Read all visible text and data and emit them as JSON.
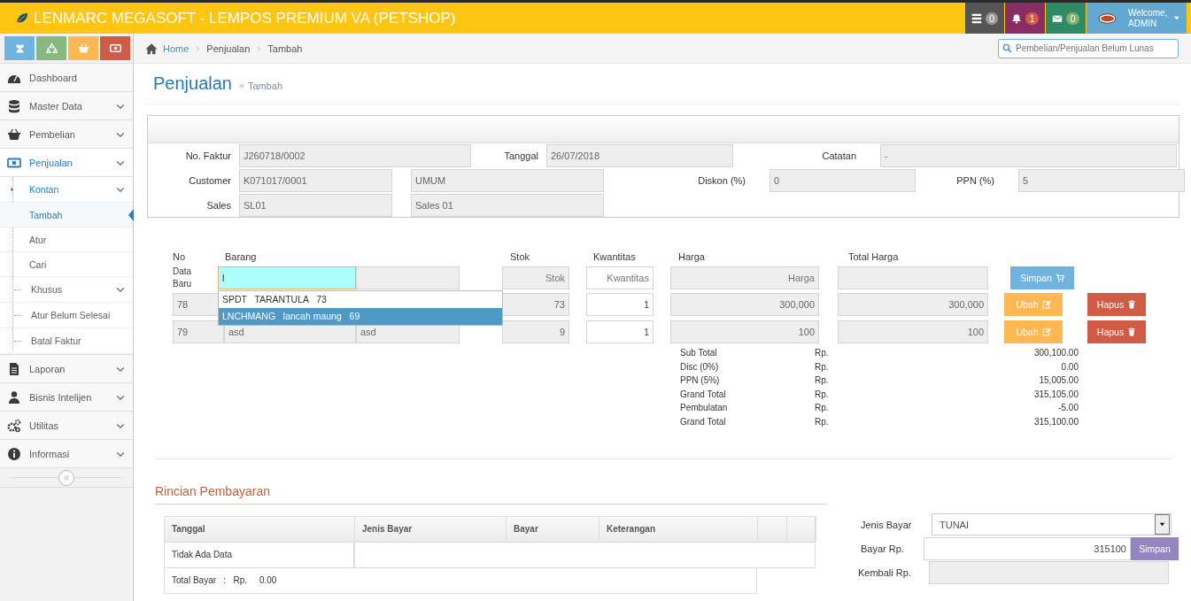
{
  "app": {
    "title": "LENMARC MEGASOFT - LEMPOS PREMIUM VA (PETSHOP)"
  },
  "topbar": {
    "tasks_badge": "0",
    "notifications_badge": "1",
    "messages_badge": "0",
    "welcome": "Welcome,",
    "user": "ADMIN"
  },
  "sidebar": {
    "shortcuts": [
      {
        "color": "#6fb3e0"
      },
      {
        "color": "#87b87f"
      },
      {
        "color": "#ffb752"
      },
      {
        "color": "#d15b47"
      }
    ],
    "menu": [
      {
        "kind": "link",
        "label": "Dashboard",
        "selected": false
      },
      {
        "kind": "submenu",
        "label": "Master Data",
        "selected": false
      },
      {
        "kind": "submenu",
        "label": "Pembelian",
        "selected": false
      },
      {
        "kind": "submenu",
        "label": "Penjualan",
        "selected": false,
        "children": [
          {
            "kind": "submenu",
            "label": "Kontan",
            "selected": false,
            "children": [
              {
                "label": "Tambah",
                "selected": true
              },
              {
                "label": "Atur",
                "selected": false
              },
              {
                "label": "Cari",
                "selected": false
              }
            ]
          },
          {
            "kind": "submenu",
            "label": "Khusus",
            "selected": false
          },
          {
            "kind": "link",
            "label": "Atur Belum Selesai",
            "selected": false
          },
          {
            "kind": "link",
            "label": "Batal Faktur",
            "selected": false
          }
        ]
      },
      {
        "kind": "submenu",
        "label": "Laporan",
        "selected": false
      },
      {
        "kind": "submenu",
        "label": "Bisnis Intelijen",
        "selected": false
      },
      {
        "kind": "submenu",
        "label": "Utilitas",
        "selected": false
      },
      {
        "kind": "submenu",
        "label": "Informasi",
        "selected": false
      }
    ]
  },
  "breadcrumb": [
    {
      "label": "Home",
      "kind": "link"
    },
    {
      "label": "Penjualan",
      "kind": "text"
    },
    {
      "label": "Tambah",
      "kind": "text"
    }
  ],
  "search": {
    "placeholder": "Pembelian/Penjualan Belum Lunas"
  },
  "page": {
    "title": "Penjualan",
    "subtitle": "Tambah"
  },
  "invoice": {
    "no_faktur": {
      "label": "No. Faktur",
      "value": "J260718/0002"
    },
    "tanggal": {
      "label": "Tanggal",
      "value": "26/07/2018"
    },
    "catatan": {
      "label": "Catatan",
      "value": "-"
    },
    "customer": {
      "label": "Customer",
      "code": "K071017/0001",
      "name": "UMUM"
    },
    "diskon": {
      "label": "Diskon (%)",
      "value": "0"
    },
    "ppn": {
      "label": "PPN (%)",
      "value": "5"
    },
    "sales": {
      "label": "Sales",
      "code": "SL01",
      "name": "Sales 01"
    }
  },
  "items": {
    "columns": [
      "No",
      "Barang",
      "Stok",
      "Kwantitas",
      "Harga",
      "Total Harga"
    ],
    "new_row": {
      "label": "Data Baru",
      "barang": "l",
      "stok_placeholder": "Stok",
      "qty_placeholder": "Kwantitas",
      "harga_placeholder": "Harga",
      "button": "Simpan"
    },
    "suggestions": [
      {
        "code": "SPDT",
        "name": "TARANTULA",
        "stock": "73",
        "selected": false
      },
      {
        "code": "LNCHMANG",
        "name": "lancah maung",
        "stock": "69",
        "selected": true
      }
    ],
    "rows": [
      {
        "no": "78",
        "stok": "73",
        "qty": "1",
        "harga": "300,000",
        "total": "300,000",
        "edit": "Ubah",
        "delete": "Hapus"
      },
      {
        "no": "79",
        "code": "asd",
        "name": "asd",
        "stok": "9",
        "qty": "1",
        "harga": "100",
        "total": "100",
        "edit": "Ubah",
        "delete": "Hapus"
      }
    ]
  },
  "totals": [
    {
      "label": "Sub Total",
      "currency": "Rp.",
      "value": "300,100.00"
    },
    {
      "label": "Disc (0%)",
      "currency": "Rp.",
      "value": "0.00"
    },
    {
      "label": "PPN (5%)",
      "currency": "Rp.",
      "value": "15,005.00"
    },
    {
      "label": "Grand Total",
      "currency": "Rp.",
      "value": "315,105.00"
    },
    {
      "label": "Pembulatan",
      "currency": "Rp.",
      "value": "-5.00"
    },
    {
      "label": "Grand Total",
      "currency": "Rp.",
      "value": "315,100.00"
    }
  ],
  "payment": {
    "title": "Rincian Pembayaran",
    "columns": [
      "Tanggal",
      "Jenis Bayar",
      "Bayar",
      "Keterangan"
    ],
    "empty_text": "Tidak Ada Data",
    "total": {
      "label": "Total Bayar",
      "separator": ":",
      "currency": "Rp.",
      "value": "0.00"
    },
    "jenis_bayar": {
      "label": "Jenis Bayar",
      "value": "TUNAI"
    },
    "bayar": {
      "label": "Bayar Rp.",
      "value": "315100",
      "button": "Simpan"
    },
    "kembali": {
      "label": "Kembali Rp."
    }
  }
}
